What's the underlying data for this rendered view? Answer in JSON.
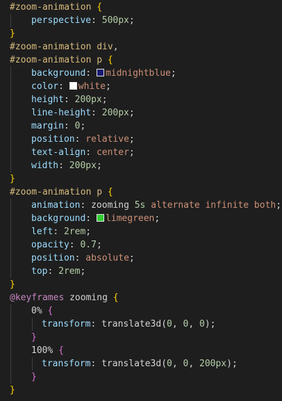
{
  "colors": {
    "background": "#1e1e1e",
    "selector": "#d7ba7d",
    "brace": "#ffd700",
    "brace_inner": "#da70d6",
    "property": "#9cdcfe",
    "punct": "#d4d4d4",
    "number": "#b5cea8",
    "string_value": "#ce9178",
    "keyword": "#c586c0",
    "identifier": "#d4d4d4"
  },
  "lines": [
    {
      "indent": 0,
      "tokens": [
        {
          "t": "#zoom-animation",
          "c": "selector"
        },
        {
          "t": " "
        },
        {
          "t": "{",
          "c": "brace"
        }
      ]
    },
    {
      "indent": 1,
      "tokens": [
        {
          "t": "perspective",
          "c": "property"
        },
        {
          "t": ": ",
          "c": "punct"
        },
        {
          "t": "500px",
          "c": "number"
        },
        {
          "t": ";",
          "c": "punct"
        }
      ]
    },
    {
      "indent": 0,
      "tokens": [
        {
          "t": "}",
          "c": "brace"
        }
      ]
    },
    {
      "indent": 0,
      "tokens": [
        {
          "t": "#zoom-animation div",
          "c": "selector"
        },
        {
          "t": ",",
          "c": "punct"
        }
      ]
    },
    {
      "indent": 0,
      "tokens": [
        {
          "t": "#zoom-animation p",
          "c": "selector"
        },
        {
          "t": " "
        },
        {
          "t": "{",
          "c": "brace"
        }
      ]
    },
    {
      "indent": 1,
      "tokens": [
        {
          "t": "background",
          "c": "property"
        },
        {
          "t": ": ",
          "c": "punct"
        },
        {
          "swatch": "#191970"
        },
        {
          "t": "midnightblue",
          "c": "string_value"
        },
        {
          "t": ";",
          "c": "punct"
        }
      ]
    },
    {
      "indent": 1,
      "tokens": [
        {
          "t": "color",
          "c": "property"
        },
        {
          "t": ": ",
          "c": "punct"
        },
        {
          "swatch": "#ffffff"
        },
        {
          "t": "white",
          "c": "string_value"
        },
        {
          "t": ";",
          "c": "punct"
        }
      ]
    },
    {
      "indent": 1,
      "tokens": [
        {
          "t": "height",
          "c": "property"
        },
        {
          "t": ": ",
          "c": "punct"
        },
        {
          "t": "200px",
          "c": "number"
        },
        {
          "t": ";",
          "c": "punct"
        }
      ]
    },
    {
      "indent": 1,
      "tokens": [
        {
          "t": "line-height",
          "c": "property"
        },
        {
          "t": ": ",
          "c": "punct"
        },
        {
          "t": "200px",
          "c": "number"
        },
        {
          "t": ";",
          "c": "punct"
        }
      ]
    },
    {
      "indent": 1,
      "tokens": [
        {
          "t": "margin",
          "c": "property"
        },
        {
          "t": ": ",
          "c": "punct"
        },
        {
          "t": "0",
          "c": "number"
        },
        {
          "t": ";",
          "c": "punct"
        }
      ]
    },
    {
      "indent": 1,
      "tokens": [
        {
          "t": "position",
          "c": "property"
        },
        {
          "t": ": ",
          "c": "punct"
        },
        {
          "t": "relative",
          "c": "string_value"
        },
        {
          "t": ";",
          "c": "punct"
        }
      ]
    },
    {
      "indent": 1,
      "tokens": [
        {
          "t": "text-align",
          "c": "property"
        },
        {
          "t": ": ",
          "c": "punct"
        },
        {
          "t": "center",
          "c": "string_value"
        },
        {
          "t": ";",
          "c": "punct"
        }
      ]
    },
    {
      "indent": 1,
      "tokens": [
        {
          "t": "width",
          "c": "property"
        },
        {
          "t": ": ",
          "c": "punct"
        },
        {
          "t": "200px",
          "c": "number"
        },
        {
          "t": ";",
          "c": "punct"
        }
      ]
    },
    {
      "indent": 0,
      "tokens": [
        {
          "t": "}",
          "c": "brace"
        }
      ]
    },
    {
      "indent": 0,
      "tokens": [
        {
          "t": "#zoom-animation p",
          "c": "selector"
        },
        {
          "t": " "
        },
        {
          "t": "{",
          "c": "brace"
        }
      ]
    },
    {
      "indent": 1,
      "tokens": [
        {
          "t": "animation",
          "c": "property"
        },
        {
          "t": ": ",
          "c": "punct"
        },
        {
          "t": "zooming",
          "c": "identifier"
        },
        {
          "t": " "
        },
        {
          "t": "5s",
          "c": "number"
        },
        {
          "t": " "
        },
        {
          "t": "alternate infinite both",
          "c": "string_value"
        },
        {
          "t": ";",
          "c": "punct"
        }
      ]
    },
    {
      "indent": 1,
      "tokens": [
        {
          "t": "background",
          "c": "property"
        },
        {
          "t": ": ",
          "c": "punct"
        },
        {
          "swatch": "#32cd32"
        },
        {
          "t": "limegreen",
          "c": "string_value"
        },
        {
          "t": ";",
          "c": "punct"
        }
      ]
    },
    {
      "indent": 1,
      "tokens": [
        {
          "t": "left",
          "c": "property"
        },
        {
          "t": ": ",
          "c": "punct"
        },
        {
          "t": "2rem",
          "c": "number"
        },
        {
          "t": ";",
          "c": "punct"
        }
      ]
    },
    {
      "indent": 1,
      "tokens": [
        {
          "t": "opacity",
          "c": "property"
        },
        {
          "t": ": ",
          "c": "punct"
        },
        {
          "t": "0.7",
          "c": "number"
        },
        {
          "t": ";",
          "c": "punct"
        }
      ]
    },
    {
      "indent": 1,
      "tokens": [
        {
          "t": "position",
          "c": "property"
        },
        {
          "t": ": ",
          "c": "punct"
        },
        {
          "t": "absolute",
          "c": "string_value"
        },
        {
          "t": ";",
          "c": "punct"
        }
      ]
    },
    {
      "indent": 1,
      "tokens": [
        {
          "t": "top",
          "c": "property"
        },
        {
          "t": ": ",
          "c": "punct"
        },
        {
          "t": "2rem",
          "c": "number"
        },
        {
          "t": ";",
          "c": "punct"
        }
      ]
    },
    {
      "indent": 0,
      "tokens": [
        {
          "t": "}",
          "c": "brace"
        }
      ]
    },
    {
      "indent": 0,
      "tokens": [
        {
          "t": "@keyframes",
          "c": "keyword"
        },
        {
          "t": " "
        },
        {
          "t": "zooming",
          "c": "identifier"
        },
        {
          "t": " "
        },
        {
          "t": "{",
          "c": "brace"
        }
      ]
    },
    {
      "indent": 1,
      "tokens": [
        {
          "t": "0%",
          "c": "identifier"
        },
        {
          "t": " "
        },
        {
          "t": "{",
          "c": "brace_inner"
        }
      ]
    },
    {
      "indent": 2,
      "tokens": [
        {
          "t": "transform",
          "c": "property"
        },
        {
          "t": ": ",
          "c": "punct"
        },
        {
          "t": "translate3d(",
          "c": "identifier"
        },
        {
          "t": "0",
          "c": "number"
        },
        {
          "t": ", ",
          "c": "punct"
        },
        {
          "t": "0",
          "c": "number"
        },
        {
          "t": ", ",
          "c": "punct"
        },
        {
          "t": "0",
          "c": "number"
        },
        {
          "t": ");",
          "c": "punct"
        }
      ]
    },
    {
      "indent": 1,
      "tokens": [
        {
          "t": "}",
          "c": "brace_inner"
        }
      ]
    },
    {
      "indent": 1,
      "tokens": [
        {
          "t": "100%",
          "c": "identifier"
        },
        {
          "t": " "
        },
        {
          "t": "{",
          "c": "brace_inner"
        }
      ]
    },
    {
      "indent": 2,
      "tokens": [
        {
          "t": "transform",
          "c": "property"
        },
        {
          "t": ": ",
          "c": "punct"
        },
        {
          "t": "translate3d(",
          "c": "identifier"
        },
        {
          "t": "0",
          "c": "number"
        },
        {
          "t": ", ",
          "c": "punct"
        },
        {
          "t": "0",
          "c": "number"
        },
        {
          "t": ", ",
          "c": "punct"
        },
        {
          "t": "200px",
          "c": "number"
        },
        {
          "t": ");",
          "c": "punct"
        }
      ]
    },
    {
      "indent": 1,
      "tokens": [
        {
          "t": "}",
          "c": "brace_inner"
        }
      ]
    },
    {
      "indent": 0,
      "tokens": [
        {
          "t": "}",
          "c": "brace"
        }
      ]
    }
  ]
}
